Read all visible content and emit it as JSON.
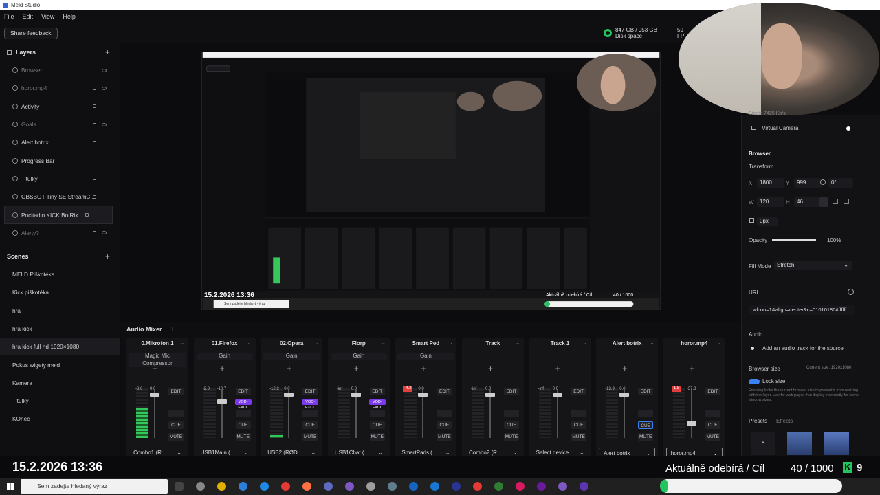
{
  "app_title": "Meld Studio",
  "menu": [
    "File",
    "Edit",
    "View",
    "Help"
  ],
  "toolbar": {
    "feedback_label": "Share feedback"
  },
  "disk": {
    "usage": "847 GB / 953 GB",
    "label": "Disk space"
  },
  "fps_partial": "59",
  "fps_label": "FP",
  "layers": {
    "title": "Layers",
    "items": [
      {
        "label": "Browser",
        "dim": true
      },
      {
        "label": "horor.mp4",
        "dim": true
      },
      {
        "label": "Activity",
        "dim": false
      },
      {
        "label": "Goals",
        "dim": true
      },
      {
        "label": "Alert botrix",
        "dim": false
      },
      {
        "label": "Progress Bar",
        "dim": false
      },
      {
        "label": "Titulky",
        "dim": false
      },
      {
        "label": "OBSBOT Tiny SE StreamC...",
        "dim": false
      },
      {
        "label": "Pocitadlo KICK BotRix",
        "dim": false,
        "selected": true
      },
      {
        "label": "Alerty?",
        "dim": true
      }
    ]
  },
  "scenes": {
    "title": "Scenes",
    "items": [
      "MELD Piškotéka",
      "Kick piškotéka",
      "hra",
      "hra kick",
      "hra kick full hd 1920×1080",
      "Pokus wigety meld",
      "Kamera",
      "Titulky",
      "KOnec"
    ],
    "selected_index": 4
  },
  "preview": {
    "date": "15.2.2026 13:36",
    "subscribers": "Aktuálně odebírá / Cíl",
    "count": "40 / 1000",
    "search": "Sem zadejte hledaný výraz"
  },
  "properties": {
    "bitrate": "Bitrate  7425 Kb/s",
    "virtual_camera": "Virtual Camera",
    "section": "Browser",
    "transform": "Transform",
    "x_label": "X",
    "x": "1800",
    "y_label": "Y",
    "y": "999",
    "rot": "0°",
    "w_label": "W",
    "w": "120",
    "h_label": "H",
    "h": "46",
    "crop": "0px",
    "opacity_label": "Opacity",
    "opacity": "100%",
    "opacity_fraction": 1.0,
    "fill_mode_label": "Fill Mode",
    "fill_mode": "Stretch",
    "url_label": "URL",
    "url": ":wlcon=1&align=center&c=01010180#ffffff",
    "audio_label": "Audio",
    "audio_add": "Add an audio track for the source",
    "browser_size": "Browser size",
    "current_size": "Current size: 1920x1080",
    "lock_size": "Lock size",
    "lock_desc": "Enabling locks the current browser size to prevent it from resizing with the layer. Use for web pages that display incorrectly for some window sizes.",
    "presets": "Presets",
    "effects": "Effects"
  },
  "mixer": {
    "title": "Audio Mixer",
    "strips": [
      {
        "name": "0.Mikrofon 1",
        "fx": [
          "Magic Mic",
          "Compressor"
        ],
        "lvl1": "-8.6",
        "lvl2": "0.0",
        "device": "Combo1 (R...",
        "meter": 0.6,
        "fader": 0.95
      },
      {
        "name": "01.Firefox",
        "fx": [
          "Gain"
        ],
        "lvl1": "-2.8",
        "lvl2": "-10.7",
        "device": "USB1Main (...",
        "meter": 0.0,
        "fader": 0.8,
        "pill": "VOD-EXCL"
      },
      {
        "name": "02.Opera",
        "fx": [
          "Gain"
        ],
        "lvl1": "-12.2",
        "lvl2": "0.0",
        "device": "USB2 (RØD...",
        "meter": 0.05,
        "fader": 0.95,
        "pill": "VOD-EXCL"
      },
      {
        "name": "Florp",
        "fx": [
          "Gain"
        ],
        "lvl1": "-inf",
        "lvl2": "0.0",
        "device": "USB1Chat (...",
        "meter": 0.0,
        "fader": 0.95,
        "pill": "VOD-EXCL"
      },
      {
        "name": "Smart Ped",
        "fx": [
          "Gain"
        ],
        "lvl1": "-4.2",
        "lvl2": "0.0",
        "device": "SmartPads (...",
        "meter": 0.0,
        "fader": 0.95,
        "red": true
      },
      {
        "name": "Track",
        "fx": [],
        "lvl1": "-inf",
        "lvl2": "0.0",
        "device": "Combo2 (R...",
        "meter": 0.0,
        "fader": 0.95
      },
      {
        "name": "Track 1",
        "fx": [],
        "lvl1": "-inf",
        "lvl2": "0.0",
        "device": "Select device",
        "meter": 0.0,
        "fader": 0.95
      },
      {
        "name": "Alert botrix",
        "fx": [],
        "lvl1": "-13.9",
        "lvl2": "0.0",
        "device": "Alert botrix",
        "meter": 0.0,
        "fader": 0.95,
        "cue": true
      },
      {
        "name": "horor.mp4",
        "fx": [],
        "lvl1": "1.8",
        "lvl2": "-37.8",
        "device": "horor.mp4",
        "meter": 0.0,
        "fader": 0.35,
        "red": true
      }
    ],
    "btn_edit": "EDIT",
    "btn_cue": "CUE",
    "btn_mute": "MUTE"
  },
  "overlay": {
    "date": "15.2.2026 13:36",
    "subscribers": "Aktuálně odebírá / Cíl",
    "count": "40 / 1000",
    "k": "K",
    "nine": "9",
    "progress_fraction": 0.04
  },
  "taskbar": {
    "search_placeholder": "Sem zadejte hledaný výraz"
  },
  "colors": {
    "accent": "#22c55e",
    "red": "#e53e3e",
    "purple": "#7c3aed"
  }
}
